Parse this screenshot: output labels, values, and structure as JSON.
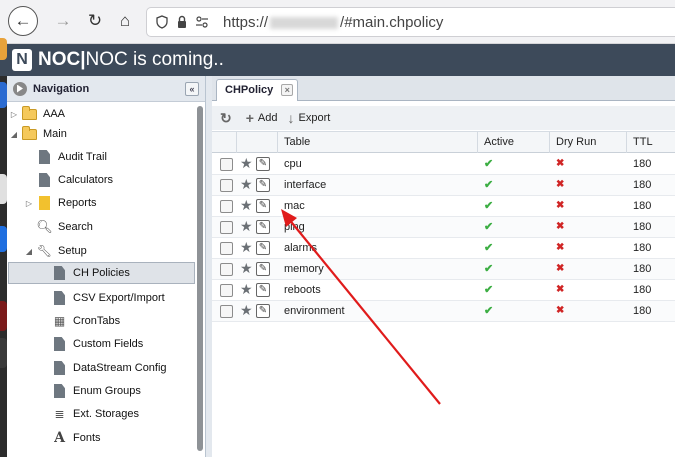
{
  "browser": {
    "url_prefix": "https://",
    "url_path": "/#main.chpolicy"
  },
  "app": {
    "logo_letter": "N",
    "title_bold": "NOC|",
    "title_rest": "NOC is coming.."
  },
  "navigation": {
    "title": "Navigation",
    "collapse_glyph": "«",
    "items": [
      {
        "label": "AAA",
        "icon": "folder-icon"
      },
      {
        "label": "Main",
        "icon": "folder-icon"
      },
      {
        "label": "Audit Trail",
        "icon": "document-icon"
      },
      {
        "label": "Calculators",
        "icon": "document-icon"
      },
      {
        "label": "Reports",
        "icon": "report-icon"
      },
      {
        "label": "Search",
        "icon": "search-icon"
      },
      {
        "label": "Setup",
        "icon": "wrench-icon"
      },
      {
        "label": "CH Policies",
        "icon": "document-icon",
        "selected": true
      },
      {
        "label": "CSV Export/Import",
        "icon": "document-icon"
      },
      {
        "label": "CronTabs",
        "icon": "calendar-icon"
      },
      {
        "label": "Custom Fields",
        "icon": "document-icon"
      },
      {
        "label": "DataStream Config",
        "icon": "document-icon"
      },
      {
        "label": "Enum Groups",
        "icon": "document-icon"
      },
      {
        "label": "Ext. Storages",
        "icon": "database-icon"
      },
      {
        "label": "Fonts",
        "icon": "font-icon"
      }
    ]
  },
  "tab": {
    "label": "CHPolicy",
    "close_glyph": "×"
  },
  "toolbar": {
    "add_label": "Add",
    "export_label": "Export"
  },
  "grid": {
    "columns": [
      "Table",
      "Active",
      "Dry Run",
      "TTL"
    ],
    "rows": [
      {
        "table": "cpu",
        "active": "✔",
        "dry_run": "✖",
        "ttl": "180"
      },
      {
        "table": "interface",
        "active": "✔",
        "dry_run": "✖",
        "ttl": "180"
      },
      {
        "table": "mac",
        "active": "✔",
        "dry_run": "✖",
        "ttl": "180"
      },
      {
        "table": "ping",
        "active": "✔",
        "dry_run": "✖",
        "ttl": "180"
      },
      {
        "table": "alarms",
        "active": "✔",
        "dry_run": "✖",
        "ttl": "180"
      },
      {
        "table": "memory",
        "active": "✔",
        "dry_run": "✖",
        "ttl": "180"
      },
      {
        "table": "reboots",
        "active": "✔",
        "dry_run": "✖",
        "ttl": "180"
      },
      {
        "table": "environment",
        "active": "✔",
        "dry_run": "✖",
        "ttl": "180"
      }
    ]
  },
  "colors": {
    "header_bg": "#3d4a5a",
    "active_check": "#3cae43",
    "dry_run_cross": "#d02525",
    "annotation_arrow": "#e01b1b"
  }
}
